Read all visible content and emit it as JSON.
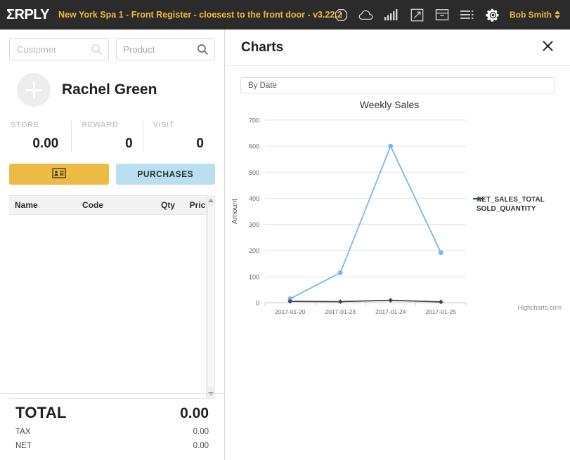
{
  "topbar": {
    "logo": "ΣRPLY",
    "store_title": "New York Spa 1 - Front Register - cloesest to the front door - v3.22.2",
    "username": "Bob Smith",
    "accent_color": "#edb93c",
    "background_color": "#2b2b2b",
    "icons": [
      {
        "name": "alert-octagon-icon",
        "label": "Alerts"
      },
      {
        "name": "cloud-icon",
        "label": "Cloud status"
      },
      {
        "name": "signal-bars-icon",
        "label": "Connection"
      },
      {
        "name": "screen-arrow-icon",
        "label": "Customer display"
      },
      {
        "name": "cash-drawer-icon",
        "label": "Cash drawer"
      },
      {
        "name": "menu-lines-icon",
        "label": "Menu"
      },
      {
        "name": "gear-icon",
        "label": "Settings"
      }
    ]
  },
  "left_panel": {
    "customer_search": {
      "placeholder": "Customer",
      "value": ""
    },
    "product_search": {
      "placeholder": "Product",
      "value": ""
    },
    "customer": {
      "name": "Rachel Green",
      "avatar_icon": "plus-circle-icon"
    },
    "stats": [
      {
        "label": "STORE",
        "value": "0.00"
      },
      {
        "label": "REWARD",
        "value": "0"
      },
      {
        "label": "VISIT",
        "value": "0"
      }
    ],
    "buttons": {
      "card_icon": "id-card-icon",
      "card_color": "#edbb45",
      "purchases_label": "PURCHASES",
      "purchases_color": "#b9e0f0"
    },
    "table": {
      "columns": [
        "Name",
        "Code",
        "Qty",
        "Price"
      ],
      "rows": []
    },
    "totals": {
      "total_label": "TOTAL",
      "total_value": "0.00",
      "tax_label": "TAX",
      "tax_value": "0.00",
      "net_label": "NET",
      "net_value": "0.00"
    }
  },
  "right_panel": {
    "title": "Charts",
    "close_icon": "close-icon",
    "filter": {
      "value": "By Date",
      "options": [
        "By Date"
      ]
    },
    "credit": "Highcharts.com"
  },
  "chart_data": {
    "type": "line",
    "title": "Weekly Sales",
    "xlabel": "",
    "ylabel": "Amount",
    "categories": [
      "2017-01-20",
      "2017-01-23",
      "2017-01-24",
      "2017-01-25"
    ],
    "series": [
      {
        "name": "NET_SALES_TOTAL",
        "color": "#7cb5ec",
        "values": [
          15,
          115,
          600,
          192
        ]
      },
      {
        "name": "SOLD_QUANTITY",
        "color": "#434348",
        "values": [
          5,
          4,
          9,
          3
        ]
      }
    ],
    "ylim": [
      0,
      700
    ],
    "yticks": [
      0,
      100,
      200,
      300,
      400,
      500,
      600,
      700
    ],
    "grid": true,
    "legend_position": "right"
  }
}
